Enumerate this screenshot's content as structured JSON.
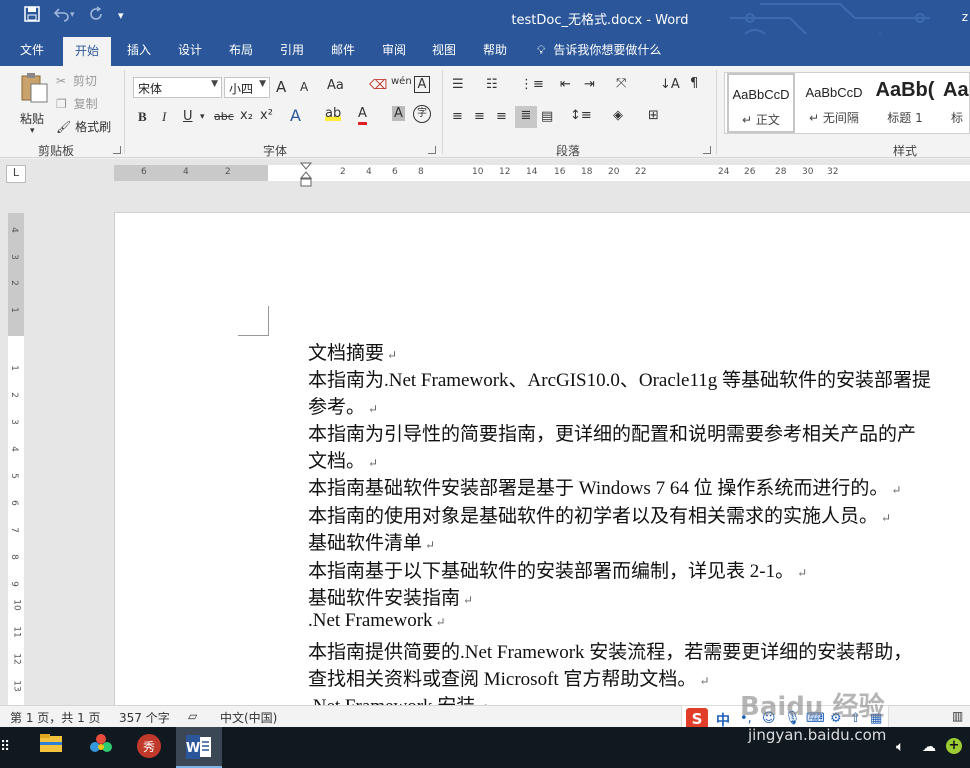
{
  "colors": {
    "brand": "#2b579a",
    "ribbon_bg": "#f3f3f3",
    "page_bg": "#ffffff",
    "taskbar": "#101820"
  },
  "title_bar": {
    "title": "testDoc_无格式.docx  -  Word",
    "user_initial": "z",
    "quick_access": {
      "save_icon": "save-icon",
      "undo_icon": "undo-icon",
      "redo_icon": "redo-icon",
      "customize": "▾"
    }
  },
  "tabs": [
    "文件",
    "开始",
    "插入",
    "设计",
    "布局",
    "引用",
    "邮件",
    "审阅",
    "视图",
    "帮助"
  ],
  "active_tab": "开始",
  "tell_me": "告诉我你想要做什么",
  "clipboard": {
    "paste": "粘贴",
    "cut": "剪切",
    "copy": "复制",
    "format_painter": "格式刷",
    "group_label": "剪贴板"
  },
  "font": {
    "font_name": "宋体",
    "font_size": "小四",
    "group_label": "字体",
    "buttons": {
      "bold": "B",
      "italic": "I",
      "underline": "U",
      "strike": "abc",
      "subscript": "x₂",
      "superscript": "x²",
      "grow": "A",
      "shrink": "A",
      "case": "Aa",
      "phonetic": "wén",
      "border": "A",
      "shade": "A",
      "circle": "字"
    }
  },
  "paragraph": {
    "group_label": "段落"
  },
  "styles": {
    "group_label": "样式",
    "items": [
      {
        "sample": "AaBbCcD",
        "name": "正文",
        "selected": true
      },
      {
        "sample": "AaBbCcD",
        "name": "无间隔",
        "selected": false
      },
      {
        "sample": "AaBb(",
        "name": "标题 1",
        "selected": false
      },
      {
        "sample": "Aa",
        "name": "标",
        "selected": false
      }
    ]
  },
  "ruler": {
    "tab_selector": "L",
    "h_labels": [
      "6",
      "4",
      "2",
      "2",
      "4",
      "6",
      "8",
      "10",
      "12",
      "14",
      "16",
      "18",
      "20",
      "22",
      "24",
      "26",
      "28",
      "30",
      "32"
    ],
    "v_labels": [
      "4",
      "3",
      "2",
      "1",
      "1",
      "2",
      "3",
      "4",
      "5",
      "6",
      "7",
      "8",
      "9",
      "10",
      "11",
      "12",
      "13"
    ]
  },
  "document": {
    "lines": [
      {
        "text": "文档摘要",
        "mark": "↵"
      },
      {
        "text": "本指南为.Net Framework、ArcGIS10.0、Oracle11g 等基础软件的安装部署提",
        "mark": ""
      },
      {
        "text": "参考。",
        "mark": "↵"
      },
      {
        "text": "本指南为引导性的简要指南，更详细的配置和说明需要参考相关产品的产",
        "mark": ""
      },
      {
        "text": "文档。",
        "mark": "↵"
      },
      {
        "text": "本指南基础软件安装部署是基于  Windows 7 64 位  操作系统而进行的。",
        "mark": "↵"
      },
      {
        "text": "本指南的使用对象是基础软件的初学者以及有相关需求的实施人员。",
        "mark": "↵"
      },
      {
        "text": "基础软件清单",
        "mark": "↵"
      },
      {
        "text": "本指南基于以下基础软件的安装部署而编制，详见表 2-1。",
        "mark": "↵"
      },
      {
        "text": "基础软件安装指南",
        "mark": "↵"
      },
      {
        "text": ".Net Framework",
        "mark": "↵"
      },
      {
        "text": "本指南提供简要的.Net Framework 安装流程，若需要更详细的安装帮助，",
        "mark": ""
      },
      {
        "text": "查找相关资料或查阅 Microsoft 官方帮助文档。",
        "mark": "↵"
      },
      {
        "text": ".Net Framework 安装",
        "mark": "↵"
      }
    ]
  },
  "status_bar": {
    "page": "第 1 页，共 1 页",
    "words": "357 个字",
    "language": "中文(中国)"
  },
  "ime": {
    "logo": "S",
    "mode": "中"
  },
  "watermark": {
    "main": "Baidu 经验",
    "url": "jingyan.baidu.com"
  }
}
